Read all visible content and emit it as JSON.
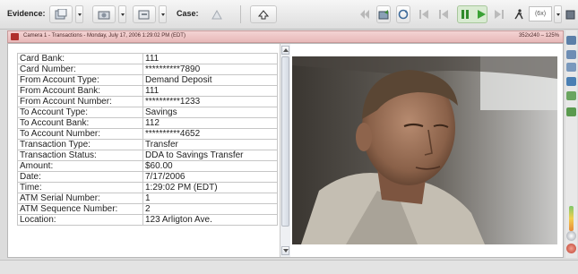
{
  "toolbar": {
    "evidence_label": "Evidence:",
    "case_label": "Case:",
    "speed_value": "(6x)"
  },
  "panel": {
    "title": "Camera 1 - Transactions - Monday, July 17, 2006 1:29:02 PM (EDT)",
    "resolution": "352x240 – 125%"
  },
  "transaction": {
    "rows": [
      {
        "label": "Card Bank:",
        "value": "111"
      },
      {
        "label": "Card Number:",
        "value": "**********7890"
      },
      {
        "label": "From Account Type:",
        "value": "Demand Deposit"
      },
      {
        "label": "From Account Bank:",
        "value": "111"
      },
      {
        "label": "From Account Number:",
        "value": "**********1233"
      },
      {
        "label": "To Account Type:",
        "value": "Savings"
      },
      {
        "label": "To Account Bank:",
        "value": "112"
      },
      {
        "label": "To Account Number:",
        "value": "**********4652"
      },
      {
        "label": "Transaction Type:",
        "value": "Transfer"
      },
      {
        "label": "Transaction Status:",
        "value": "DDA to Savings Transfer"
      },
      {
        "label": "Amount:",
        "value": "$60.00"
      },
      {
        "label": "Date:",
        "value": "7/17/2006"
      },
      {
        "label": "Time:",
        "value": "1:29:02 PM (EDT)"
      },
      {
        "label": "ATM Serial Number:",
        "value": "1"
      },
      {
        "label": "ATM Sequence Number:",
        "value": "2"
      },
      {
        "label": "Location:",
        "value": "123 Arligton Ave."
      }
    ]
  },
  "colors": {
    "title_bar": "#e8b9b9",
    "play_active": "#3a9a35",
    "video_bg": "#2b2a26"
  },
  "icons": [
    "evidence-icon",
    "camera-icon",
    "export-icon",
    "case-icon",
    "bookmark-icon",
    "skip-start-icon",
    "skip-back-icon",
    "pause-icon",
    "play-icon",
    "skip-end-icon",
    "runner-icon",
    "settings-icon"
  ]
}
